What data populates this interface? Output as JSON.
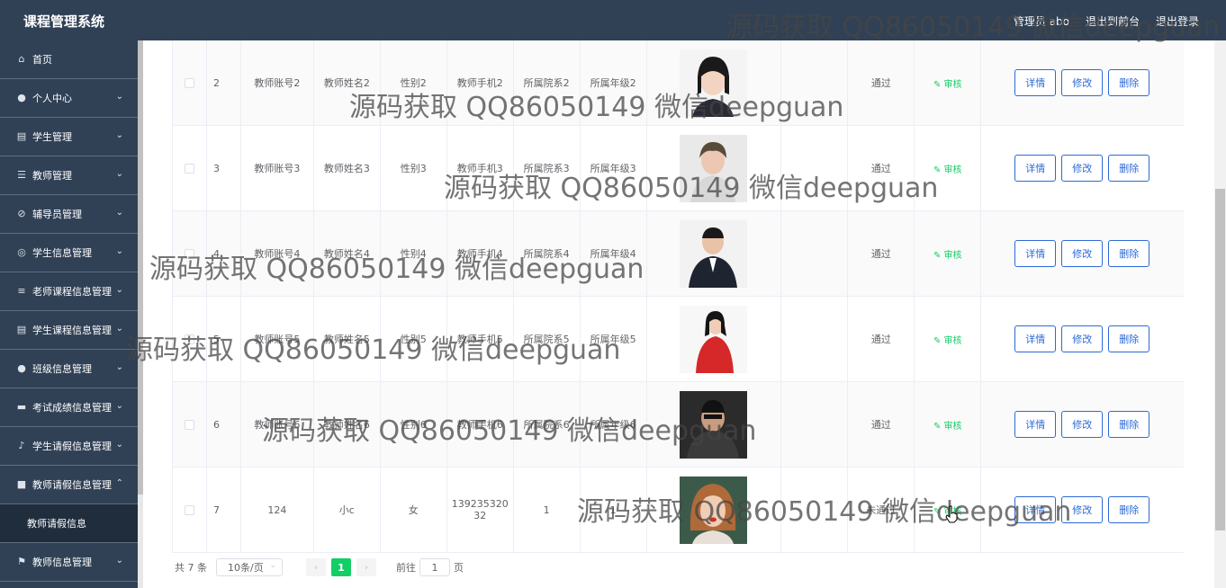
{
  "header": {
    "app_title": "课程管理系统",
    "user_label": "管理员 abo",
    "back_label": "退出到前台",
    "logout_label": "退出登录"
  },
  "sidebar": {
    "items": [
      {
        "label": "首页",
        "icon": "home-icon",
        "glyph": "⌂",
        "expandable": false
      },
      {
        "label": "个人中心",
        "icon": "user-icon",
        "glyph": "●",
        "expandable": true
      },
      {
        "label": "学生管理",
        "icon": "clipboard-icon",
        "glyph": "▤",
        "expandable": true
      },
      {
        "label": "教师管理",
        "icon": "sliders-icon",
        "glyph": "☰",
        "expandable": true
      },
      {
        "label": "辅导员管理",
        "icon": "bell-off-icon",
        "glyph": "⊘",
        "expandable": true
      },
      {
        "label": "学生信息管理",
        "icon": "compass-icon",
        "glyph": "◎",
        "expandable": true
      },
      {
        "label": "老师课程信息管理",
        "icon": "list-icon",
        "glyph": "≡",
        "expandable": true
      },
      {
        "label": "学生课程信息管理",
        "icon": "document-icon",
        "glyph": "▤",
        "expandable": true
      },
      {
        "label": "班级信息管理",
        "icon": "user-icon",
        "glyph": "●",
        "expandable": true
      },
      {
        "label": "考试成绩信息管理",
        "icon": "cup-icon",
        "glyph": "▬",
        "expandable": true
      },
      {
        "label": "学生请假信息管理",
        "icon": "microphone-icon",
        "glyph": "♪",
        "expandable": true
      },
      {
        "label": "教师请假信息管理",
        "icon": "video-icon",
        "glyph": "■",
        "expandable": true,
        "open": true
      }
    ],
    "sub_item": "教师请假信息",
    "last_item": {
      "label": "教师信息管理",
      "icon": "flag-icon",
      "glyph": "⚑"
    }
  },
  "table": {
    "rows": [
      {
        "idx": "2",
        "account": "教师账号2",
        "name": "教师姓名2",
        "sex": "性别2",
        "phone": "教师手机2",
        "dept": "所属院系2",
        "grade": "所属年级2",
        "status": "通过",
        "photo": "p1"
      },
      {
        "idx": "3",
        "account": "教师账号3",
        "name": "教师姓名3",
        "sex": "性别3",
        "phone": "教师手机3",
        "dept": "所属院系3",
        "grade": "所属年级3",
        "status": "通过",
        "photo": "p2"
      },
      {
        "idx": "4",
        "account": "教师账号4",
        "name": "教师姓名4",
        "sex": "性别4",
        "phone": "教师手机4",
        "dept": "所属院系4",
        "grade": "所属年级4",
        "status": "通过",
        "photo": "p3"
      },
      {
        "idx": "5",
        "account": "教师账号5",
        "name": "教师姓名5",
        "sex": "性别5",
        "phone": "教师手机5",
        "dept": "所属院系5",
        "grade": "所属年级5",
        "status": "通过",
        "photo": "p4"
      },
      {
        "idx": "6",
        "account": "教师账号6",
        "name": "教师姓名6",
        "sex": "性别6",
        "phone": "教师手机6",
        "dept": "所属院系6",
        "grade": "所属年级6",
        "status": "通过",
        "photo": "p5"
      },
      {
        "idx": "7",
        "account": "124",
        "name": "小c",
        "sex": "女",
        "phone": "139235320 32",
        "dept": "1",
        "grade": "1",
        "status": "未通过",
        "photo": "p6"
      }
    ],
    "audit_label": "审核",
    "detail_label": "详情",
    "edit_label": "修改",
    "delete_label": "删除"
  },
  "pagination": {
    "total": "共 7 条",
    "page_size": "10条/页",
    "current_page": "1",
    "goto_prefix": "前往",
    "goto_value": "1",
    "goto_suffix": "页"
  },
  "watermark": {
    "text": "源码获取 QQ86050149 微信deepguan"
  },
  "colors": {
    "sidebar_bg": "#304156",
    "accent_green": "#13ce66",
    "button_blue": "#2d6ad6"
  }
}
